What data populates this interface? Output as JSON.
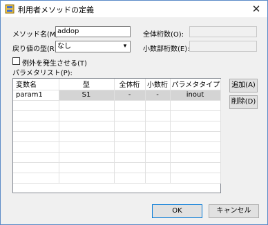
{
  "window": {
    "title": "利用者メソッドの定義",
    "close_glyph": "✕",
    "close_icon": "close-icon",
    "app_icon": "database-icon"
  },
  "form": {
    "method_name_label": "メソッド名(M):",
    "method_name_value": "addop",
    "return_type_label": "戻り値の型(R):",
    "return_type_value": "なし",
    "total_digits_label": "全体桁数(O):",
    "total_digits_value": "",
    "decimal_digits_label": "小数部桁数(E):",
    "decimal_digits_value": "",
    "raise_exception_label": "例外を発生させる(T)",
    "raise_exception_checked": false,
    "param_list_label": "パラメタリスト(P):"
  },
  "params_table": {
    "headers": [
      "変数名",
      "型",
      "全体桁",
      "小数桁",
      "パラメタタイプ"
    ],
    "rows": [
      [
        "param1",
        "S1",
        "-",
        "-",
        "inout"
      ]
    ],
    "empty_rows": 8
  },
  "buttons": {
    "add": "追加(A)",
    "delete": "削除(D)",
    "ok": "OK",
    "cancel": "キャンセル"
  },
  "colors": {
    "accent": "#0078d7",
    "selection": "#d4d4d4"
  }
}
